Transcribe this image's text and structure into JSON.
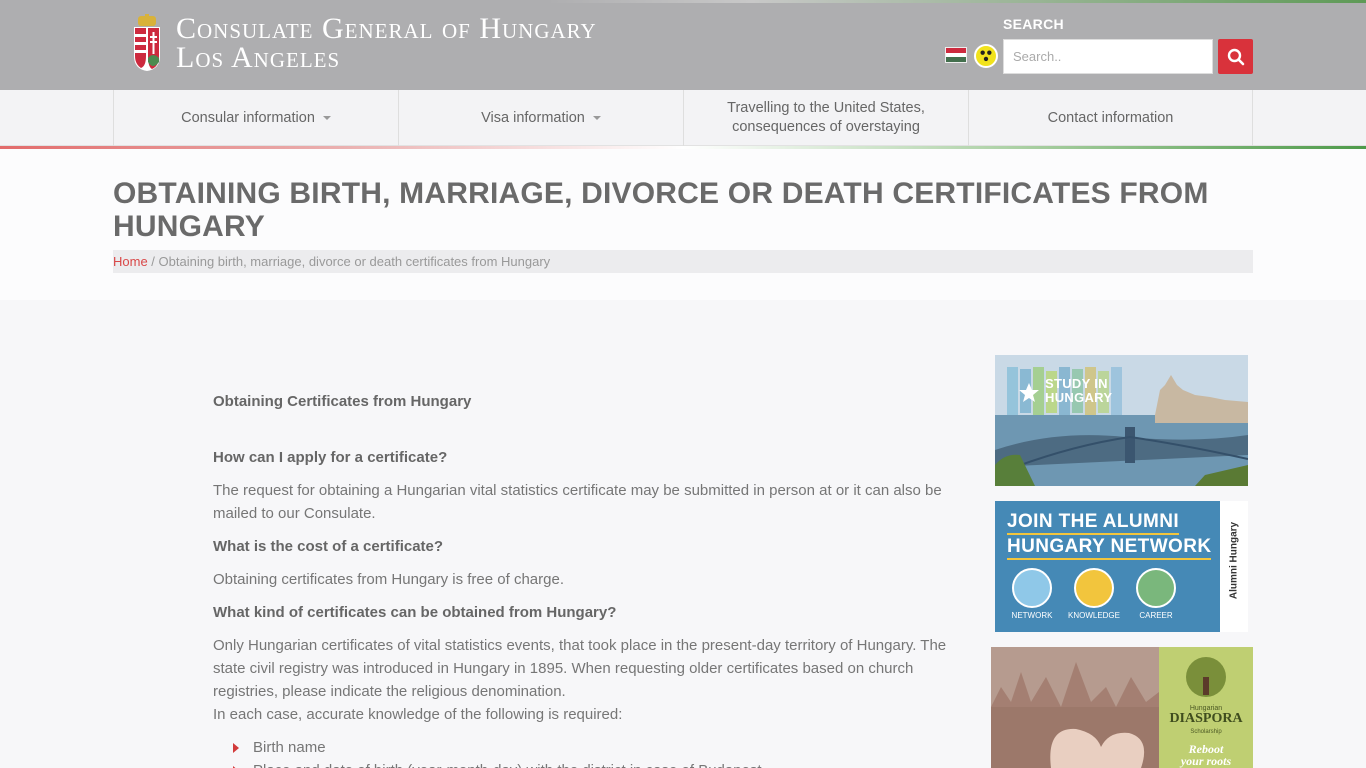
{
  "header": {
    "title_line1": "Consulate General of Hungary",
    "title_line2": "Los Angeles",
    "search_label": "SEARCH",
    "search_placeholder": "Search..",
    "flag_colors": [
      "#cd2a3e",
      "#ffffff",
      "#436f4d"
    ],
    "accent_color": "#d9323b"
  },
  "nav": {
    "items": [
      {
        "label": "Consular information",
        "has_dropdown": true
      },
      {
        "label": "Visa information",
        "has_dropdown": true
      },
      {
        "label": "Travelling to the United States, consequences of overstaying",
        "has_dropdown": false
      },
      {
        "label": "Contact information",
        "has_dropdown": false
      }
    ]
  },
  "page": {
    "title": "OBTAINING BIRTH, MARRIAGE, DIVORCE OR DEATH CERTIFICATES FROM HUNGARY",
    "breadcrumb_home": "Home",
    "breadcrumb_sep": " / ",
    "breadcrumb_current": "Obtaining birth, marriage, divorce or death certificates from Hungary"
  },
  "content": {
    "heading": "Obtaining Certificates from Hungary",
    "q1": "How can I apply for a certificate?",
    "a1": "The request for obtaining a Hungarian vital statistics certificate may be submitted in person at or it can also be mailed to our Consulate.",
    "q2": "What is the cost of a certificate?",
    "a2": "Obtaining certificates from Hungary is free of charge.",
    "q3": "What kind of certificates can be obtained from Hungary?",
    "a3_p1": "Only Hungarian certificates of vital statistics events, that took place in the present-day territory of Hungary. The state civil registry was introduced in Hungary in 1895. When requesting older certificates based on church registries, please indicate the religious denomination.",
    "a3_p2": "In each case, accurate knowledge of the following is required:",
    "list": [
      "Birth name",
      "Place and date of birth (year-month-day) with the district in case of Budapest"
    ]
  },
  "sidebar": {
    "banner1_text": "STUDY IN HUNGARY",
    "banner2_title_line1": "JOIN THE ALUMNI",
    "banner2_title_line2": "HUNGARY NETWORK",
    "banner2_labels": [
      "NETWORK",
      "KNOWLEDGE",
      "CAREER"
    ],
    "banner2_side": "Alumni Hungary",
    "banner3_small": "Hungarian",
    "banner3_title": "DIASPORA",
    "banner3_sub": "Scholarship",
    "banner3_tag_line1": "Reboot",
    "banner3_tag_line2": "your roots"
  }
}
